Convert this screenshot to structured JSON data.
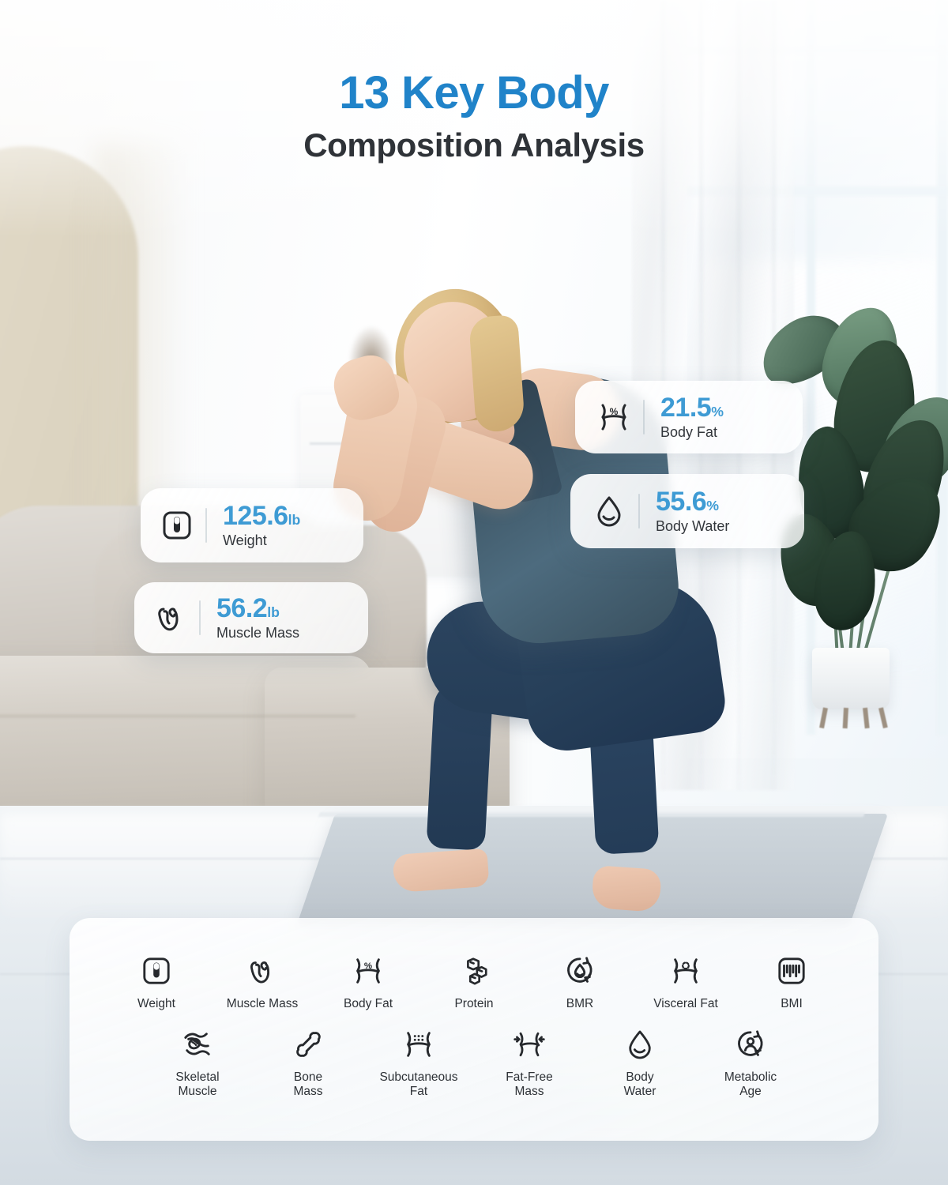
{
  "title": {
    "line1": "13 Key Body",
    "line2": "Composition Analysis",
    "accent_color": "#2083C9",
    "dark_color": "#2f3338"
  },
  "stat_cards": [
    {
      "id": "weight",
      "icon": "scale-icon",
      "value": "125.6",
      "unit": "lb",
      "label": "Weight"
    },
    {
      "id": "muscle",
      "icon": "bicep-icon",
      "value": "56.2",
      "unit": "lb",
      "label": "Muscle Mass"
    },
    {
      "id": "bodyfat",
      "icon": "body-fat-icon",
      "value": "21.5",
      "unit": "%",
      "label": "Body Fat"
    },
    {
      "id": "water",
      "icon": "water-drop-icon",
      "value": "55.6",
      "unit": "%",
      "label": "Body Water"
    }
  ],
  "stat_value_color": "#3E9BD4",
  "features": {
    "row1": [
      {
        "icon": "scale-icon",
        "label": "Weight"
      },
      {
        "icon": "bicep-icon",
        "label": "Muscle Mass"
      },
      {
        "icon": "body-fat-icon",
        "label": "Body Fat"
      },
      {
        "icon": "protein-icon",
        "label": "Protein"
      },
      {
        "icon": "bmr-flame-icon",
        "label": "BMR"
      },
      {
        "icon": "visceral-fat-icon",
        "label": "Visceral Fat"
      },
      {
        "icon": "bmi-scale-icon",
        "label": "BMI"
      }
    ],
    "row2": [
      {
        "icon": "skeletal-muscle-icon",
        "label": "Skeletal\nMuscle"
      },
      {
        "icon": "bone-icon",
        "label": "Bone\nMass"
      },
      {
        "icon": "subcutaneous-fat-icon",
        "label": "Subcutaneous\nFat"
      },
      {
        "icon": "fat-free-mass-icon",
        "label": "Fat-Free\nMass"
      },
      {
        "icon": "water-drop-icon",
        "label": "Body\nWater"
      },
      {
        "icon": "metabolic-age-icon",
        "label": "Metabolic\nAge"
      }
    ]
  },
  "scene": {
    "description": "woman doing squat on yoga mat in bright living room",
    "sofa_color": "#d3cec7",
    "plant_color": "#2b4438",
    "outfit_color": "#3f5868"
  }
}
